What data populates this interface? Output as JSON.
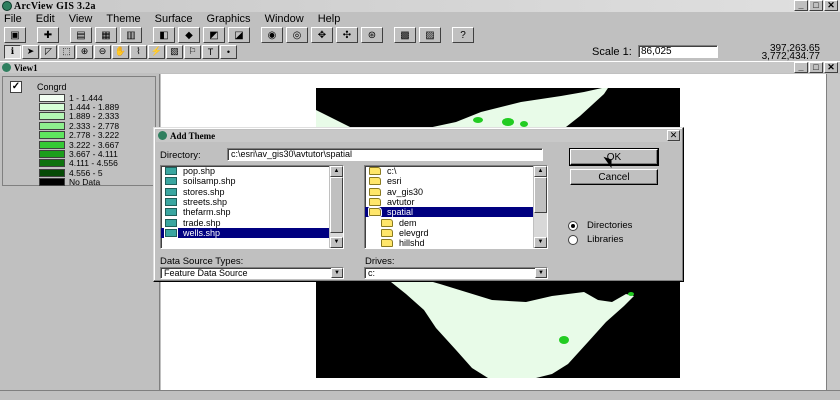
{
  "app": {
    "title": "ArcView GIS 3.2a"
  },
  "menu": [
    "File",
    "Edit",
    "View",
    "Theme",
    "Surface",
    "Graphics",
    "Window",
    "Help"
  ],
  "scale": {
    "label": "Scale 1:",
    "value": "86,025"
  },
  "coords": {
    "x": "397,263.65",
    "y": "3,772,434.77"
  },
  "view": {
    "title": "View1"
  },
  "legend": {
    "layer_name": "Congrd",
    "checked": true,
    "classes": [
      {
        "label": "1 - 1.444",
        "color": "#f3fff3"
      },
      {
        "label": "1.444 - 1.889",
        "color": "#d6ffd6"
      },
      {
        "label": "1.889 - 2.333",
        "color": "#b4f7b4"
      },
      {
        "label": "2.333 - 2.778",
        "color": "#8ef08e"
      },
      {
        "label": "2.778 - 3.222",
        "color": "#5ee65e"
      },
      {
        "label": "3.222 - 3.667",
        "color": "#35c935"
      },
      {
        "label": "3.667 - 4.111",
        "color": "#1c9e1c"
      },
      {
        "label": "4.111 - 4.556",
        "color": "#0d720d"
      },
      {
        "label": "4.556 - 5",
        "color": "#064a06"
      },
      {
        "label": "No Data",
        "color": "#000000"
      }
    ]
  },
  "dialog": {
    "title": "Add Theme",
    "directory_label": "Directory:",
    "directory_value": "c:\\esri\\av_gis30\\avtutor\\spatial",
    "files": [
      {
        "name": "pop.shp",
        "selected": false
      },
      {
        "name": "soilsamp.shp",
        "selected": false
      },
      {
        "name": "stores.shp",
        "selected": false
      },
      {
        "name": "streets.shp",
        "selected": false
      },
      {
        "name": "thefarm.shp",
        "selected": false
      },
      {
        "name": "trade.shp",
        "selected": false
      },
      {
        "name": "wells.shp",
        "selected": true
      }
    ],
    "folders": [
      {
        "name": "c:\\",
        "open": true,
        "indent": 0,
        "selected": false
      },
      {
        "name": "esri",
        "open": true,
        "indent": 0,
        "selected": false
      },
      {
        "name": "av_gis30",
        "open": true,
        "indent": 0,
        "selected": false
      },
      {
        "name": "avtutor",
        "open": true,
        "indent": 0,
        "selected": false
      },
      {
        "name": "spatial",
        "open": true,
        "indent": 0,
        "selected": true
      },
      {
        "name": "dem",
        "open": false,
        "indent": 1,
        "selected": false
      },
      {
        "name": "elevgrd",
        "open": false,
        "indent": 1,
        "selected": false
      },
      {
        "name": "hillshd",
        "open": false,
        "indent": 1,
        "selected": false
      }
    ],
    "data_source_label": "Data Source Types:",
    "data_source_value": "Feature Data Source",
    "drives_label": "Drives:",
    "drives_value": "c:",
    "ok_label": "OK",
    "cancel_label": "Cancel",
    "radio_directories": "Directories",
    "radio_libraries": "Libraries",
    "selected_radio": "Directories"
  },
  "map": {
    "background": "#000000",
    "land_color": "#e8fbe8",
    "hotspot_color": "#22cc22"
  }
}
